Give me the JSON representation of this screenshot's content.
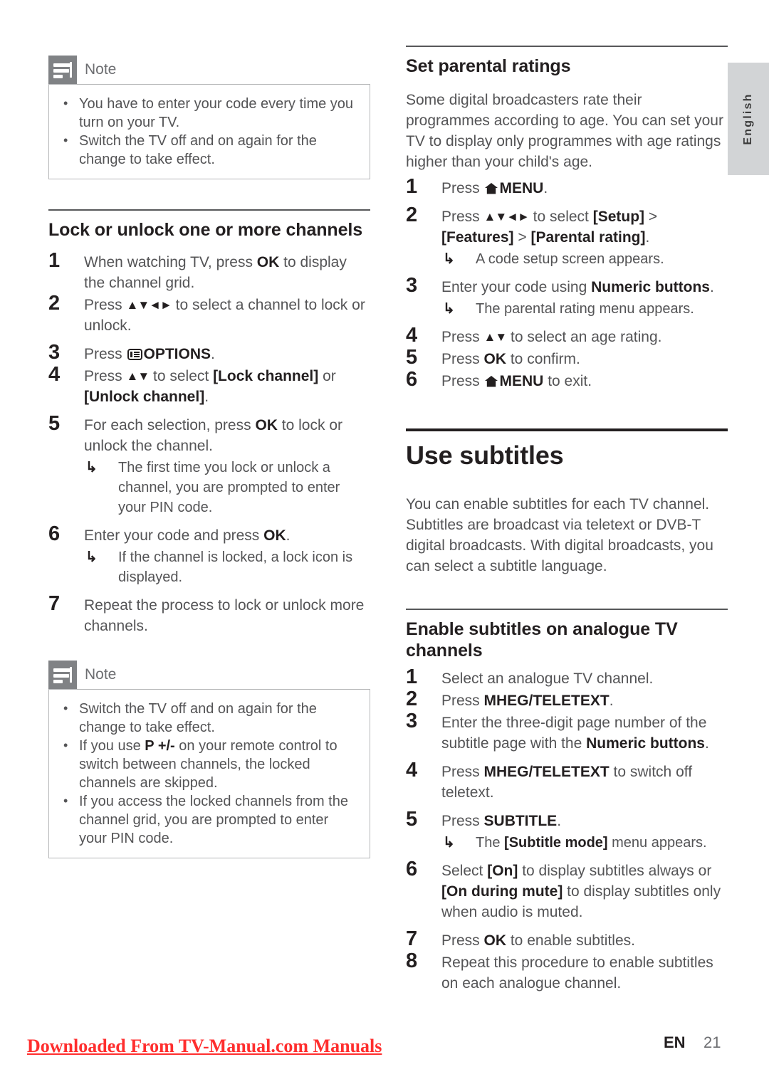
{
  "page": {
    "language_tab": "English",
    "footer": {
      "watermark": "Downloaded From TV-Manual.com Manuals",
      "lang_code": "EN",
      "page_number": "21"
    },
    "colors": {
      "heading": "#231f20",
      "body_text": "#545456",
      "note_tab": "#808285",
      "note_border": "#b5b6b8",
      "lang_tab_bg": "#d2d4d6",
      "watermark": "#ff2e2e"
    }
  },
  "left_column": {
    "note_top": {
      "label": "Note",
      "items": [
        "You have to enter your code every time you turn on your TV.",
        "Switch the TV off and on again for the change to take effect."
      ]
    },
    "section_lock": {
      "heading": "Lock or unlock one or more channels",
      "steps": [
        {
          "num": "1",
          "text_parts": [
            {
              "t": "When watching TV, press ",
              "b": false
            },
            {
              "t": "OK",
              "b": true
            },
            {
              "t": " to display the channel grid.",
              "b": false
            }
          ]
        },
        {
          "num": "2",
          "prefix": "Press ",
          "navkeys": "▲▼◄►",
          "suffix": " to select a channel to lock or unlock."
        },
        {
          "num": "3",
          "prefix": "Press ",
          "icon": "options-icon",
          "bold": "OPTIONS",
          "suffix": "."
        },
        {
          "num": "4",
          "prefix": "Press ",
          "navkeys": "▲▼",
          "mid": " to select ",
          "bold1": "[Lock channel]",
          "mid2": " or ",
          "bold2": "[Unlock channel]",
          "suffix": "."
        },
        {
          "num": "5",
          "prefix": "For each selection, press ",
          "bold": "OK",
          "suffix": " to lock or unlock the channel.",
          "result": "The first time you lock or unlock a channel, you are prompted to enter your PIN code."
        },
        {
          "num": "6",
          "prefix": "Enter your code and press ",
          "bold": "OK",
          "suffix": ".",
          "result": "If the channel is locked, a lock icon is displayed."
        },
        {
          "num": "7",
          "text": "Repeat the process to lock or unlock more channels."
        }
      ]
    },
    "note_bottom": {
      "label": "Note",
      "items": [
        "Switch the TV off and on again for the change to take effect.",
        "If you use P +/- on your remote control to switch between channels, the locked channels are skipped.",
        "If you access the locked channels from the channel grid, you are prompted to enter your PIN code."
      ],
      "item2_bold": "P +/-"
    }
  },
  "right_column": {
    "section_ratings": {
      "heading": "Set parental ratings",
      "intro": "Some digital broadcasters rate their programmes according to age. You can set your TV to display only programmes with age ratings higher than your child's age.",
      "steps": [
        {
          "num": "1",
          "prefix": "Press ",
          "icon": "home-icon",
          "bold": "MENU",
          "suffix": "."
        },
        {
          "num": "2",
          "prefix": "Press ",
          "navkeys": "▲▼◄►",
          "mid": " to select ",
          "bold1": "[Setup]",
          "gt1": " > ",
          "bold2": "[Features]",
          "gt2": " > ",
          "bold3": "[Parental rating]",
          "suffix": ".",
          "result": "A code setup screen appears."
        },
        {
          "num": "3",
          "prefix": "Enter your code using ",
          "bold": "Numeric buttons",
          "suffix": ".",
          "result": "The parental rating menu appears."
        },
        {
          "num": "4",
          "prefix": "Press ",
          "navkeys": "▲▼",
          "suffix": " to select an age rating."
        },
        {
          "num": "5",
          "prefix": "Press ",
          "bold": "OK",
          "suffix": " to confirm."
        },
        {
          "num": "6",
          "prefix": "Press ",
          "icon": "home-icon",
          "bold": "MENU",
          "suffix": " to exit."
        }
      ]
    },
    "section_subtitles": {
      "heading": "Use subtitles",
      "intro": "You can enable subtitles for each TV channel. Subtitles are broadcast via teletext or DVB-T digital broadcasts. With digital broadcasts, you can select a subtitle language."
    },
    "section_analogue": {
      "heading": "Enable subtitles on analogue TV channels",
      "steps": [
        {
          "num": "1",
          "text": "Select an analogue TV channel."
        },
        {
          "num": "2",
          "prefix": "Press ",
          "bold": "MHEG/TELETEXT",
          "suffix": "."
        },
        {
          "num": "3",
          "prefix": "Enter the three-digit page number of the subtitle page with the ",
          "bold": "Numeric buttons",
          "suffix": "."
        },
        {
          "num": "4",
          "prefix": "Press ",
          "bold": "MHEG/TELETEXT",
          "suffix": " to switch off teletext."
        },
        {
          "num": "5",
          "prefix": "Press ",
          "bold": "SUBTITLE",
          "suffix": ".",
          "result_prefix": "The ",
          "result_bold": "[Subtitle mode]",
          "result_suffix": " menu appears."
        },
        {
          "num": "6",
          "prefix": "Select ",
          "bold1": "[On]",
          "mid": " to display subtitles always or ",
          "bold2": "[On during mute]",
          "suffix": " to display subtitles only when audio is muted."
        },
        {
          "num": "7",
          "prefix": "Press ",
          "bold": "OK",
          "suffix": " to enable subtitles."
        },
        {
          "num": "8",
          "text": "Repeat this procedure to enable subtitles on each analogue channel."
        }
      ]
    }
  }
}
